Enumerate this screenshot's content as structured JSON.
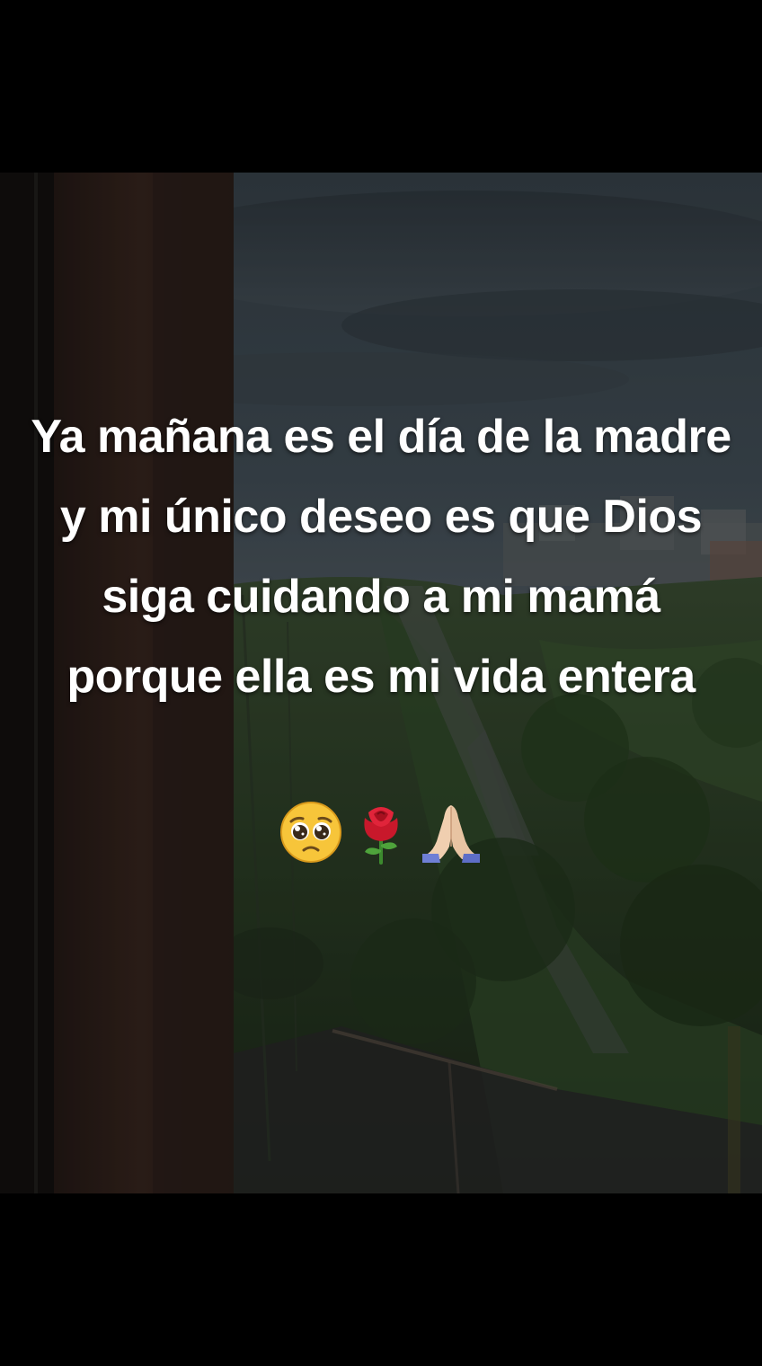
{
  "caption": {
    "text": "Ya mañana es el día de la madre y mi único deseo es que Dios siga cuidando a mi mamá porque ella es mi vida entera",
    "emojis": [
      "pleading-face",
      "rose",
      "folded-hands"
    ]
  },
  "colors": {
    "letterbox": "#000000",
    "text": "#ffffff",
    "sky": "#3a4650",
    "foliage": "#2f4a2a",
    "wall": "#3d2a22"
  }
}
